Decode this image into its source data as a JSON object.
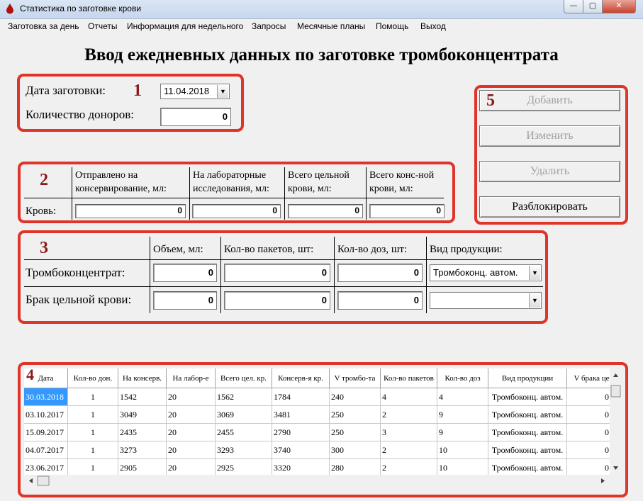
{
  "window": {
    "title": "Статистика по заготовке крови",
    "min_glyph": "—",
    "max_glyph": "▢",
    "close_glyph": "✕"
  },
  "menu": [
    "Заготовка за день",
    "Отчеты",
    "Информация для недельного",
    "Запросы",
    "Месячные планы",
    "Помощь",
    "Выход"
  ],
  "heading": "Ввод ежедневных данных по заготовке тромбоконцентрата",
  "section1": {
    "num": "1",
    "date_label": "Дата заготовки:",
    "date_value": "11.04.2018",
    "donors_label": "Количество доноров:",
    "donors_value": "0"
  },
  "section2": {
    "num": "2",
    "headers": [
      "Отправлено на консервирование, мл:",
      "На лабораторные исследования, мл:",
      "Всего цельной крови, мл:",
      "Всего конс-ной крови, мл:"
    ],
    "row_label": "Кровь:",
    "values": [
      "0",
      "0",
      "0",
      "0"
    ]
  },
  "section3": {
    "num": "3",
    "headers": [
      "Объем, мл:",
      "Кол-во пакетов, шт:",
      "Кол-во доз, шт:",
      "Вид продукции:"
    ],
    "rows": [
      {
        "label": "Тромбоконцентрат:",
        "values": [
          "0",
          "0",
          "0"
        ],
        "product": "Тромбоконц. автом."
      },
      {
        "label": "Брак цельной крови:",
        "values": [
          "0",
          "0",
          "0"
        ],
        "product": ""
      }
    ]
  },
  "section5": {
    "num": "5",
    "buttons": {
      "add": "Добавить",
      "edit": "Изменить",
      "delete": "Удалить",
      "unlock": "Разблокировать"
    }
  },
  "table": {
    "num": "4",
    "columns": [
      "Дата",
      "Кол-во дон.",
      "На консерв.",
      "На лабор-е",
      "Всего цел. кр.",
      "Консерв-я кр.",
      "V тромбо-та",
      "Кол-во пакетов",
      "Кол-во доз",
      "Вид продукции",
      "V брака це"
    ],
    "rows": [
      [
        "30.03.2018",
        "1",
        "1542",
        "20",
        "1562",
        "1784",
        "240",
        "4",
        "4",
        "Тромбоконц. автом.",
        "0"
      ],
      [
        "03.10.2017",
        "1",
        "3049",
        "20",
        "3069",
        "3481",
        "250",
        "2",
        "9",
        "Тромбоконц. автом.",
        "0"
      ],
      [
        "15.09.2017",
        "1",
        "2435",
        "20",
        "2455",
        "2790",
        "250",
        "3",
        "9",
        "Тромбоконц. автом.",
        "0"
      ],
      [
        "04.07.2017",
        "1",
        "3273",
        "20",
        "3293",
        "3740",
        "300",
        "2",
        "10",
        "Тромбоконц. автом.",
        "0"
      ],
      [
        "23.06.2017",
        "1",
        "2905",
        "20",
        "2925",
        "3320",
        "280",
        "2",
        "10",
        "Тромбоконц. автом.",
        "0"
      ]
    ]
  },
  "colors": {
    "highlight_border": "#e0342a",
    "number_color": "#8b1a1a",
    "selection": "#3399ff"
  }
}
